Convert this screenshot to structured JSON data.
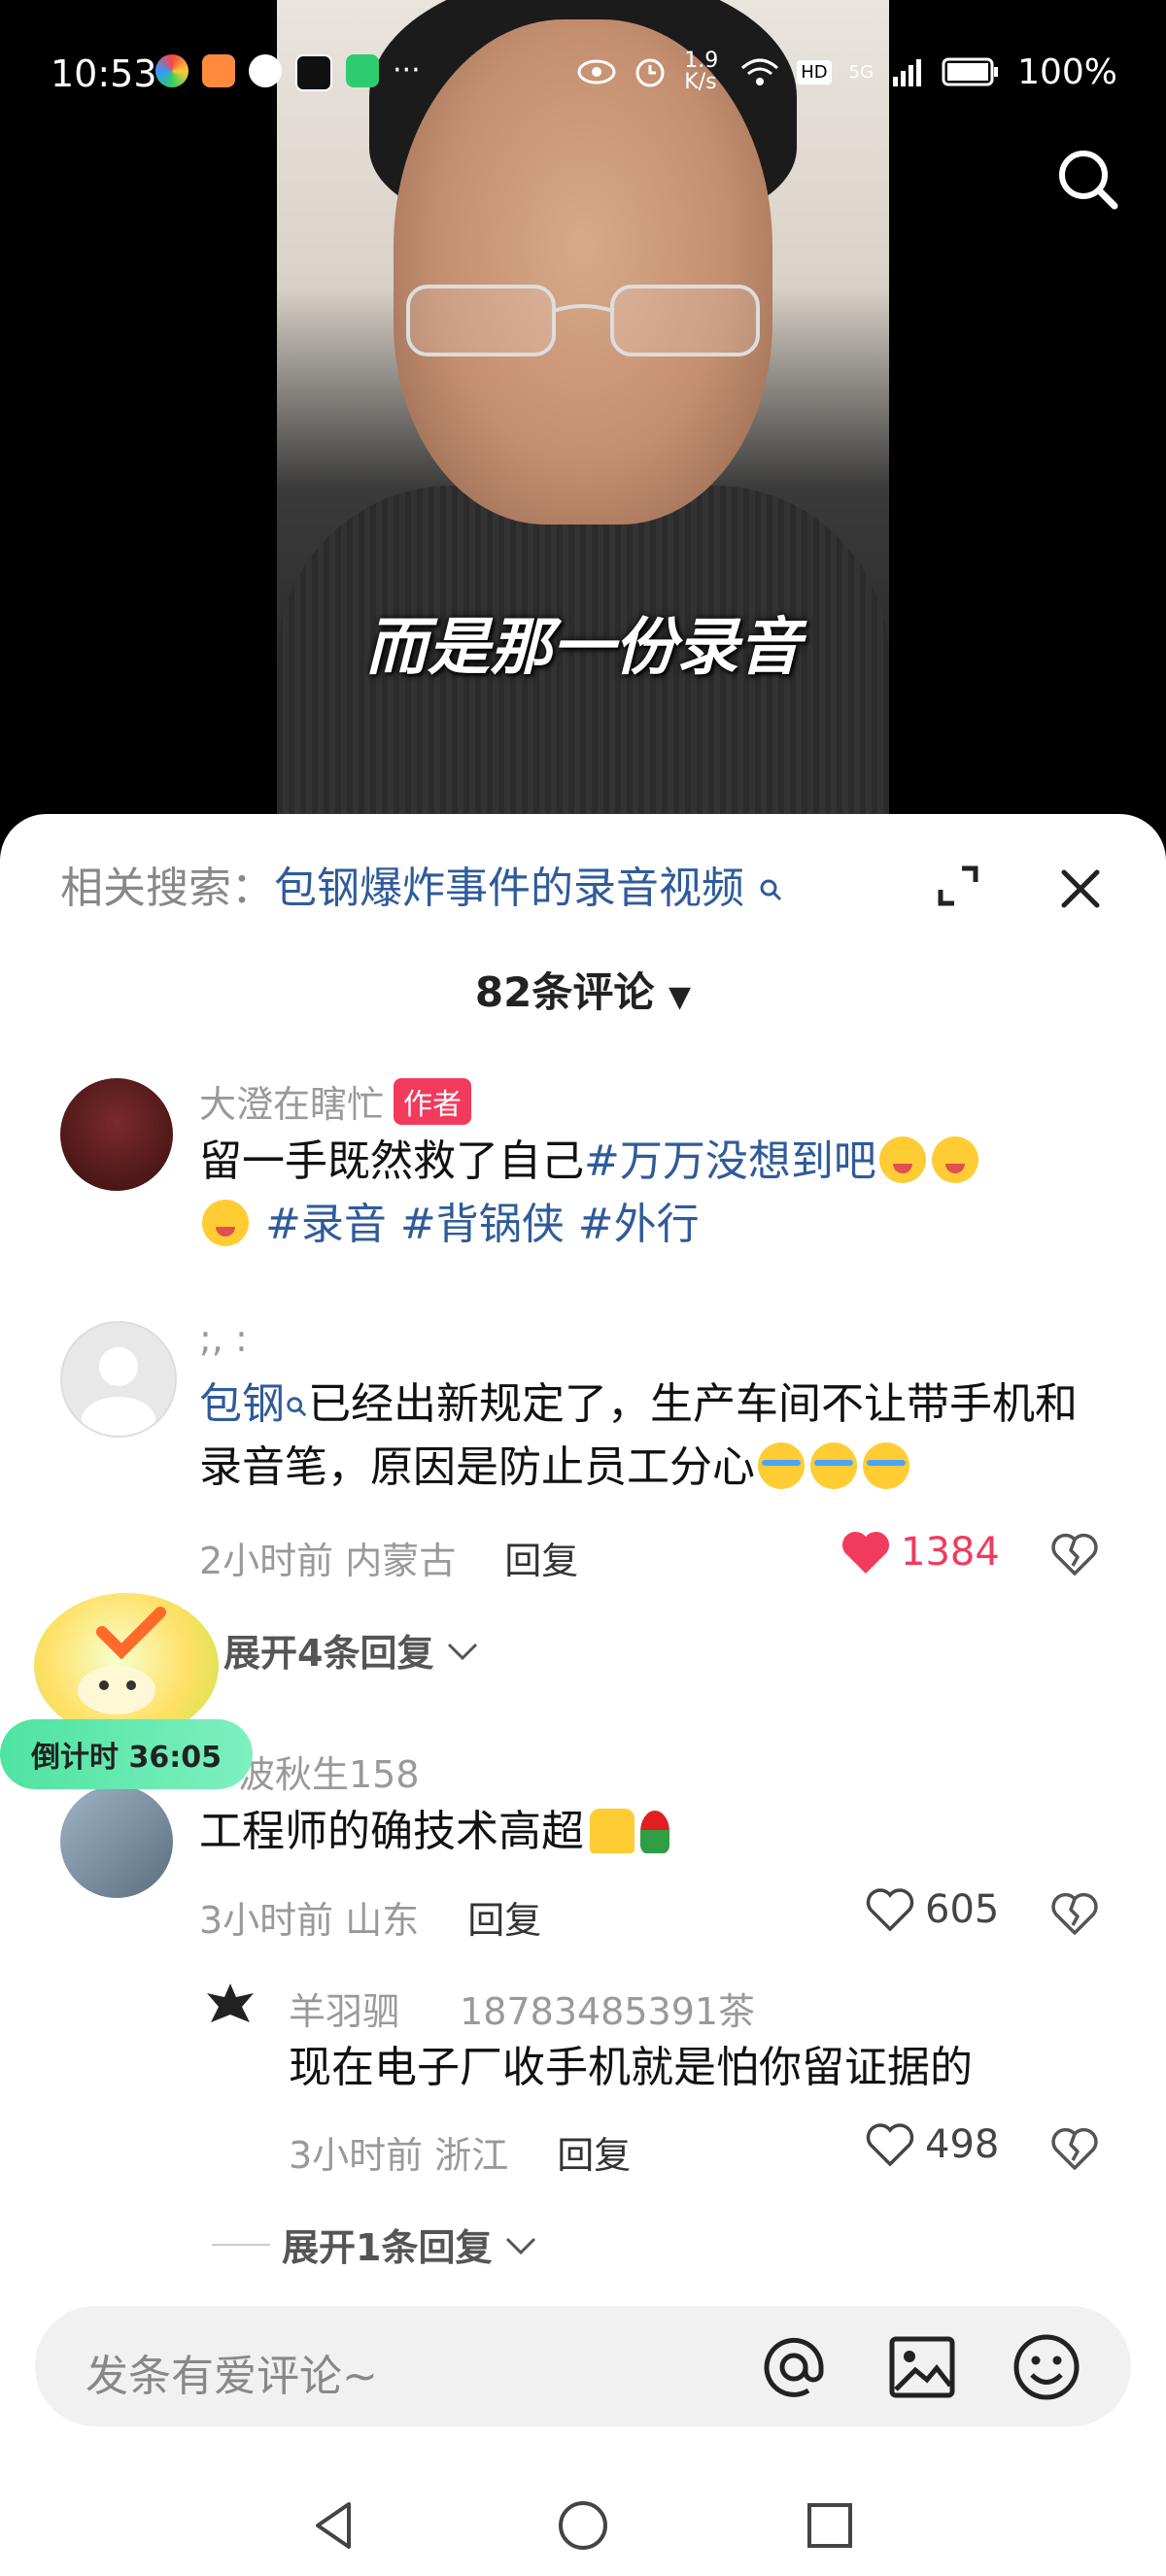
{
  "status_bar": {
    "time": "10:53",
    "network_speed": "1.9 K/s",
    "battery": "100%",
    "signal_label": "5G",
    "hd_label": "HD"
  },
  "video": {
    "subtitle": "而是那一份录音"
  },
  "sheet": {
    "related_label": "相关搜索：",
    "related_keyword": "包钢爆炸事件的录音视频",
    "comment_count": "82条评论"
  },
  "comments": [
    {
      "user": "大澄在瞎忙",
      "badge": "作者",
      "text_prefix": "留一手既然救了自己",
      "hashtags": [
        "#万万没想到吧",
        "#录音",
        "#背锅侠",
        "#外行"
      ]
    },
    {
      "user": ";, :",
      "mention": "包钢",
      "text": "已经出新规定了，生产车间不让带手机和录音笔，原因是防止员工分心",
      "time": "2小时前",
      "location": "内蒙古",
      "reply": "回复",
      "likes": "1384",
      "expand": "展开4条回复"
    },
    {
      "user": "波秋生158",
      "text": "工程师的确技术高超",
      "time": "3小时前",
      "location": "山东",
      "reply": "回复",
      "likes": "605"
    },
    {
      "user": "羊羽驷",
      "reply_to": "18783485391茶",
      "text": "现在电子厂收手机就是怕你留证据的",
      "time": "3小时前",
      "location": "浙江",
      "reply": "回复",
      "likes": "498",
      "expand": "展开1条回复"
    }
  ],
  "countdown": "倒计时 36:05",
  "input": {
    "placeholder": "发条有爱评论~"
  },
  "colors": {
    "accent": "#f23a5d",
    "link": "#2f5b9a"
  }
}
